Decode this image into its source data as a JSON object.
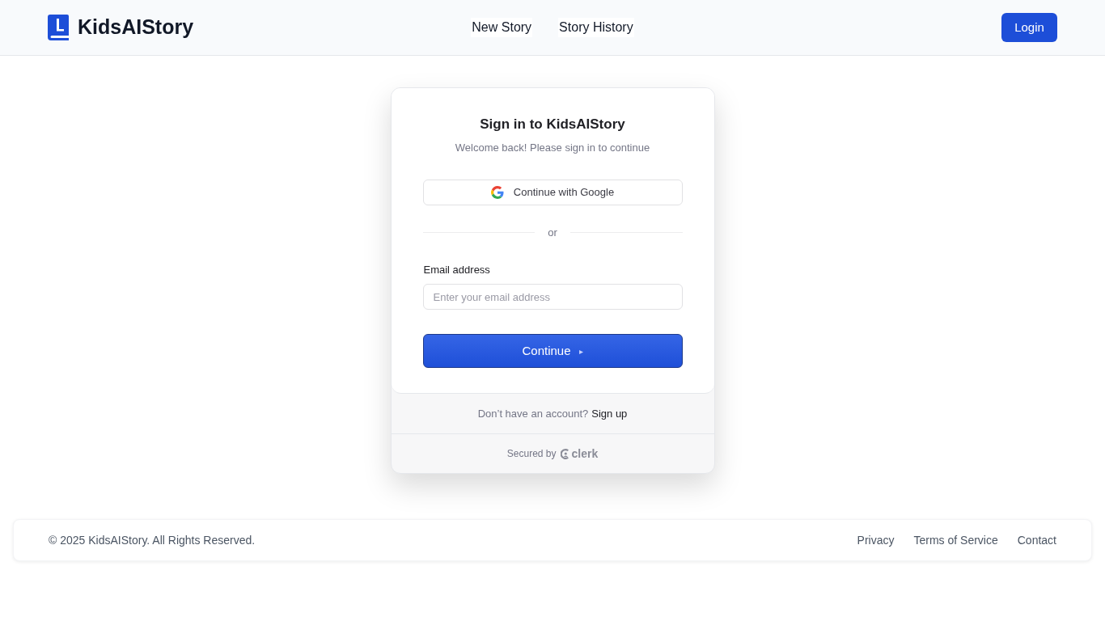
{
  "header": {
    "brand": "KidsAIStory",
    "nav": [
      "New Story",
      "Story History"
    ],
    "login_button": "Login"
  },
  "signin_card": {
    "title": "Sign in to KidsAIStory",
    "subtitle": "Welcome back! Please sign in to continue",
    "google_button": "Continue with Google",
    "divider": "or",
    "email_label": "Email address",
    "email_placeholder": "Enter your email address",
    "continue_button": "Continue",
    "continue_arrow": "▸",
    "signup_prompt": "Don’t have an account?",
    "signup_link": "Sign up",
    "secured_by": "Secured by",
    "provider": "clerk"
  },
  "footer": {
    "copyright": "© 2025 KidsAIStory. All Rights Reserved.",
    "links": [
      "Privacy",
      "Terms of Service",
      "Contact"
    ]
  }
}
